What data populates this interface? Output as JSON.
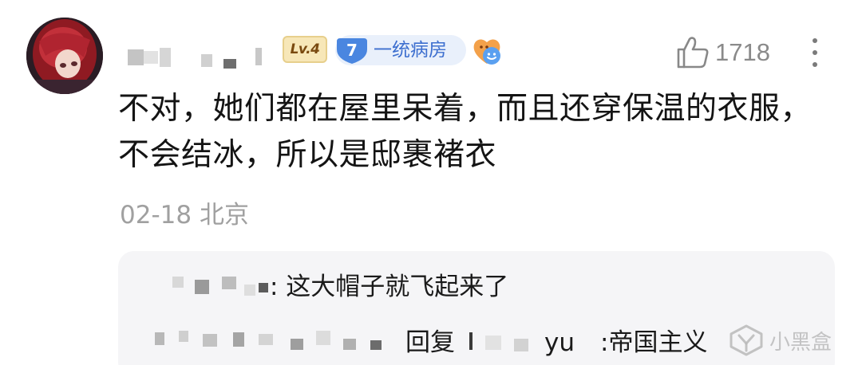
{
  "comment": {
    "level_badge": "Lv.4",
    "fan_badge": {
      "number": "7",
      "label": "一统病房"
    },
    "like_count": "1718",
    "text_line1": "不对，她们都在屋里呆着，而且还穿保温的衣服，",
    "text_line2": "不会结冰，所以是邸裹褚衣",
    "date": "02-18",
    "location": "北京"
  },
  "replies": [
    {
      "text": ": 这大帽子就飞起来了"
    },
    {
      "reply_word": "回复",
      "reply_to_tail": "yu",
      "text": ":帝国主义"
    }
  ],
  "watermark": {
    "text": "小黑盒"
  },
  "colors": {
    "level_badge_bg": "#f7e7b8",
    "fan_badge_bg": "#e9f0fb",
    "fan_badge_text": "#3d6fcf",
    "meta_gray": "#a0a0a0",
    "reply_bg": "#f5f5f7"
  },
  "icons": {
    "like": "thumbs-up-icon",
    "more": "more-vertical-icon",
    "emoji": "smiley-badge-icon",
    "watermark": "heybox-logo-icon"
  }
}
